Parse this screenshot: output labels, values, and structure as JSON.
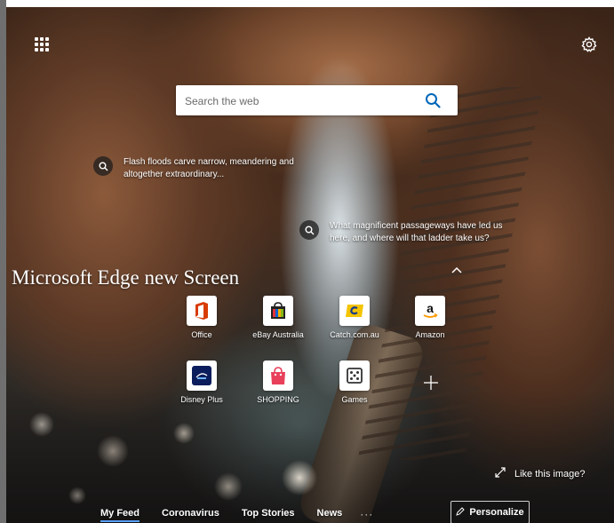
{
  "search": {
    "placeholder": "Search the web"
  },
  "hotspots": [
    {
      "text": "Flash floods carve narrow, meandering and altogether extraordinary..."
    },
    {
      "text": "What magnificent passageways have led us here, and where will that ladder take us?"
    }
  ],
  "section_heading": "Microsoft Edge new Screen",
  "tiles": [
    {
      "label": "Office",
      "icon": "office-icon",
      "color": "#d83b01"
    },
    {
      "label": "eBay Australia",
      "icon": "ebay-icon",
      "color": "#0064d2"
    },
    {
      "label": "Catch.com.au",
      "icon": "catch-icon",
      "color": "#f5c400"
    },
    {
      "label": "Amazon",
      "icon": "amazon-icon",
      "color": "#ff9900"
    },
    {
      "label": "Disney Plus",
      "icon": "disney-plus-icon",
      "color": "#0b1d5c"
    },
    {
      "label": "SHOPPING",
      "icon": "shopping-bag-icon",
      "color": "#e8405b"
    },
    {
      "label": "Games",
      "icon": "games-icon",
      "color": "#333333"
    }
  ],
  "like_image": "Like this image?",
  "feed_tabs": [
    {
      "label": "My Feed",
      "active": true
    },
    {
      "label": "Coronavirus",
      "active": false
    },
    {
      "label": "Top Stories",
      "active": false
    },
    {
      "label": "News",
      "active": false
    }
  ],
  "more_label": "···",
  "personalize_label": "Personalize",
  "colors": {
    "accent": "#0067b8",
    "tab_underline": "#5aa0ff"
  }
}
